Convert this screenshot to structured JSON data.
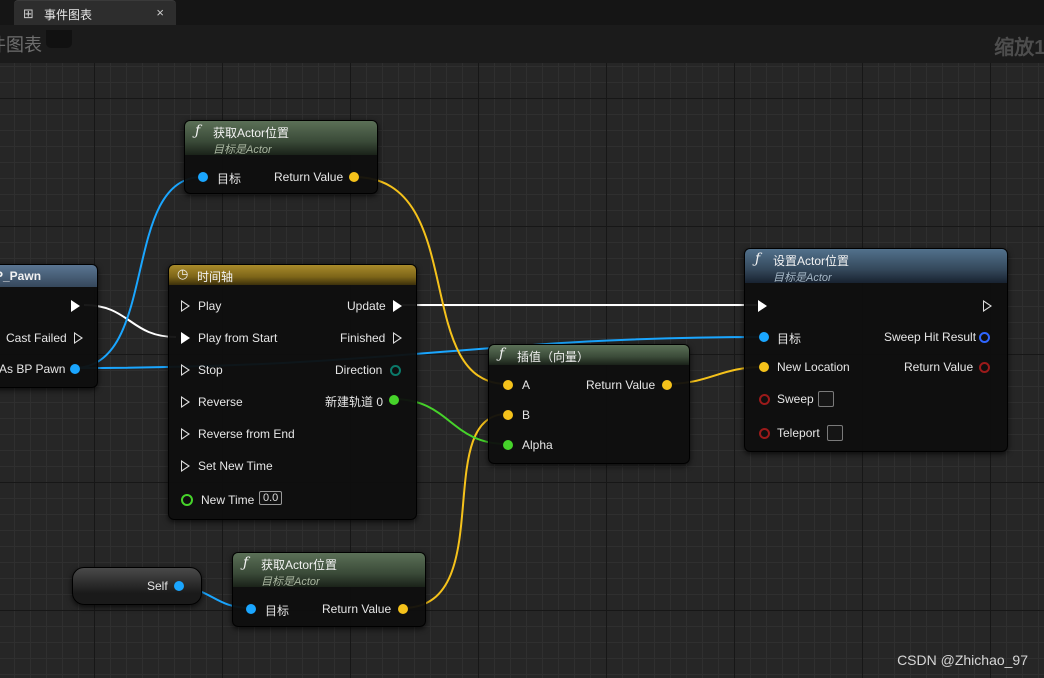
{
  "tab": {
    "label": "事件图表",
    "icon": "graph-icon",
    "close": "×"
  },
  "titlebar": {
    "left": "件图表",
    "right": "缩放1:"
  },
  "nodes": {
    "get_actor_top": {
      "title": "获取Actor位置",
      "subtitle": "目标是Actor",
      "pin_target": "目标",
      "pin_return": "Return Value"
    },
    "cast_partial": {
      "title": "P_Pawn",
      "pin_failed": "Cast Failed",
      "pin_as": "As BP Pawn"
    },
    "timeline": {
      "title": "时间轴",
      "pins_in": [
        "Play",
        "Play from Start",
        "Stop",
        "Reverse",
        "Reverse from End",
        "Set New Time"
      ],
      "pin_newtime": "New Time",
      "newtime_value": "0.0",
      "pins_out": [
        "Update",
        "Finished",
        "Direction",
        "新建轨道 0"
      ]
    },
    "lerp": {
      "title": "插值（向量）",
      "pin_a": "A",
      "pin_b": "B",
      "pin_alpha": "Alpha",
      "pin_return": "Return Value"
    },
    "set_actor": {
      "title": "设置Actor位置",
      "subtitle": "目标是Actor",
      "pin_target": "目标",
      "pin_location": "New Location",
      "pin_sweep": "Sweep",
      "pin_teleport": "Teleport",
      "pin_sweep_hit": "Sweep Hit Result",
      "pin_return": "Return Value"
    },
    "self_node": {
      "label": "Self"
    },
    "get_actor_bottom": {
      "title": "获取Actor位置",
      "subtitle": "目标是Actor",
      "pin_target": "目标",
      "pin_return": "Return Value"
    }
  },
  "colors": {
    "exec": "#ffffff",
    "object": "#1aa6ff",
    "vector": "#f5c21b",
    "float": "#46d32a",
    "struct": "#2f66ff",
    "bool": "#9b1a1a"
  },
  "watermark": "CSDN @Zhichao_97"
}
